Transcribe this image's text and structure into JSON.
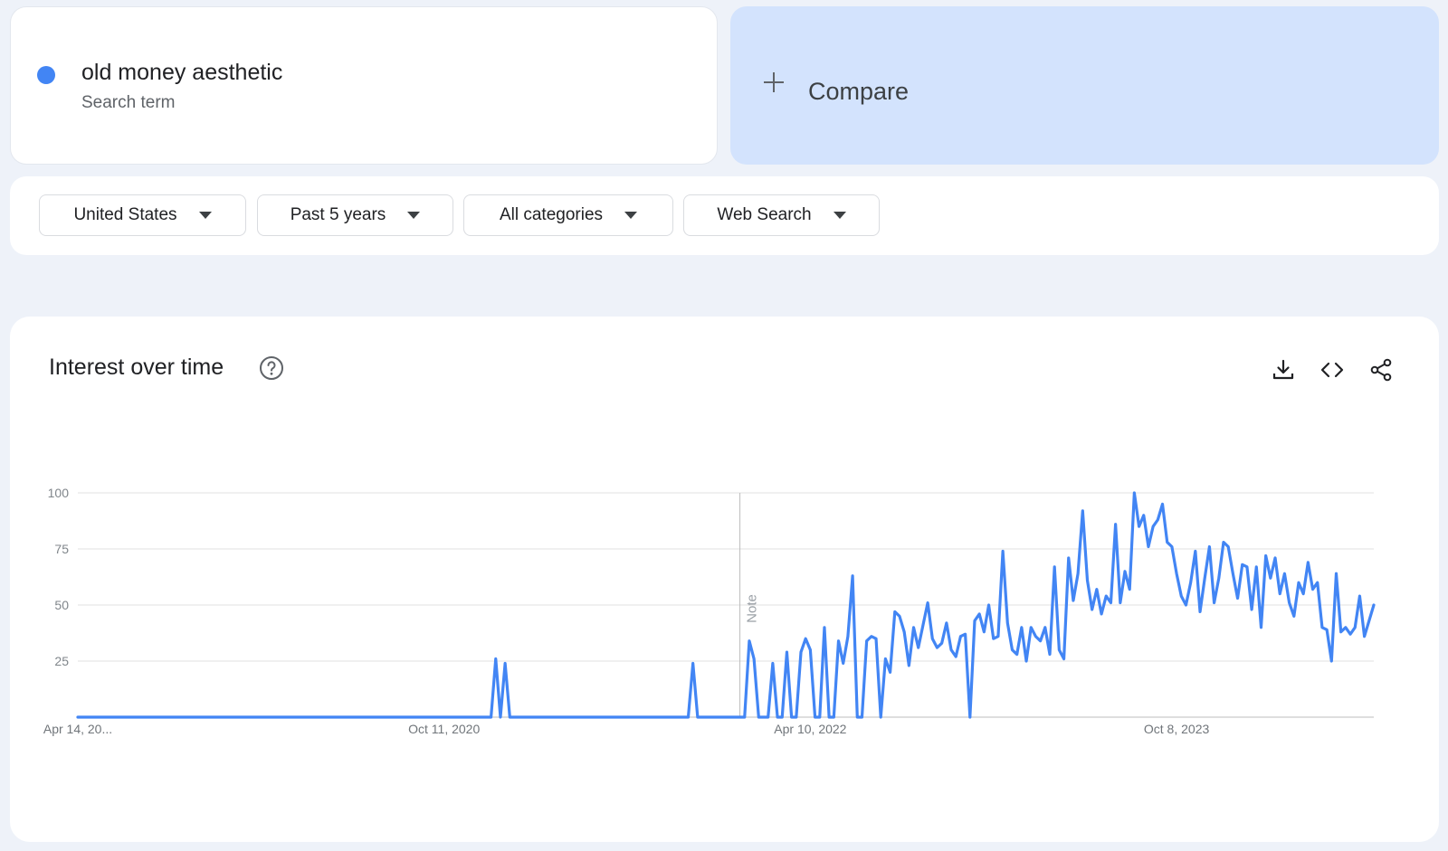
{
  "search_term": {
    "name": "old money aesthetic",
    "subtitle": "Search term",
    "color": "#4285f4"
  },
  "compare": {
    "label": "Compare",
    "icon": "plus-icon"
  },
  "filters": [
    {
      "label": "United States"
    },
    {
      "label": "Past 5 years"
    },
    {
      "label": "All categories"
    },
    {
      "label": "Web Search"
    }
  ],
  "chart_card": {
    "title": "Interest over time",
    "help_icon": "help-circle-icon",
    "tools": [
      "download-icon",
      "embed-code-icon",
      "share-icon"
    ]
  },
  "chart_data": {
    "type": "line",
    "title": "Interest over time",
    "xlabel": "",
    "ylabel": "",
    "ylim": [
      0,
      100
    ],
    "yticks": [
      25,
      50,
      75,
      100
    ],
    "xtick_labels": [
      "Apr 14, 20...",
      "Oct 11, 2020",
      "Apr 10, 2022",
      "Oct 8, 2023"
    ],
    "xtick_index": [
      0,
      78,
      156,
      234
    ],
    "grid": true,
    "legend": "none",
    "annotations": [
      {
        "label": "Note",
        "index": 141
      }
    ],
    "series": [
      {
        "color": "#4285f4",
        "values": [
          0,
          0,
          0,
          0,
          0,
          0,
          0,
          0,
          0,
          0,
          0,
          0,
          0,
          0,
          0,
          0,
          0,
          0,
          0,
          0,
          0,
          0,
          0,
          0,
          0,
          0,
          0,
          0,
          0,
          0,
          0,
          0,
          0,
          0,
          0,
          0,
          0,
          0,
          0,
          0,
          0,
          0,
          0,
          0,
          0,
          0,
          0,
          0,
          0,
          0,
          0,
          0,
          0,
          0,
          0,
          0,
          0,
          0,
          0,
          0,
          0,
          0,
          0,
          0,
          0,
          0,
          0,
          0,
          0,
          0,
          0,
          0,
          0,
          0,
          0,
          0,
          0,
          0,
          0,
          0,
          0,
          0,
          0,
          0,
          0,
          0,
          0,
          0,
          0,
          26,
          0,
          24,
          0,
          0,
          0,
          0,
          0,
          0,
          0,
          0,
          0,
          0,
          0,
          0,
          0,
          0,
          0,
          0,
          0,
          0,
          0,
          0,
          0,
          0,
          0,
          0,
          0,
          0,
          0,
          0,
          0,
          0,
          0,
          0,
          0,
          0,
          0,
          0,
          0,
          0,
          0,
          24,
          0,
          0,
          0,
          0,
          0,
          0,
          0,
          0,
          0,
          0,
          0,
          34,
          26,
          0,
          0,
          0,
          24,
          0,
          0,
          29,
          0,
          0,
          29,
          35,
          30,
          0,
          0,
          40,
          0,
          0,
          34,
          24,
          36,
          63,
          0,
          0,
          34,
          36,
          35,
          0,
          26,
          20,
          47,
          45,
          38,
          23,
          40,
          31,
          41,
          51,
          35,
          31,
          33,
          42,
          30,
          27,
          36,
          37,
          0,
          43,
          46,
          38,
          50,
          35,
          36,
          74,
          42,
          30,
          28,
          40,
          25,
          40,
          36,
          34,
          40,
          28,
          67,
          30,
          26,
          71,
          52,
          64,
          92,
          61,
          48,
          57,
          46,
          54,
          51,
          86,
          51,
          65,
          57,
          100,
          85,
          90,
          76,
          85,
          88,
          95,
          78,
          76,
          64,
          54,
          50,
          60,
          74,
          47,
          62,
          76,
          51,
          62,
          78,
          76,
          64,
          53,
          68,
          67,
          48,
          67,
          40,
          72,
          62,
          71,
          55,
          64,
          51,
          45,
          60,
          55,
          69,
          57,
          60,
          40,
          39,
          25,
          64,
          38,
          40,
          37,
          40,
          54,
          36,
          43,
          50
        ]
      }
    ]
  }
}
